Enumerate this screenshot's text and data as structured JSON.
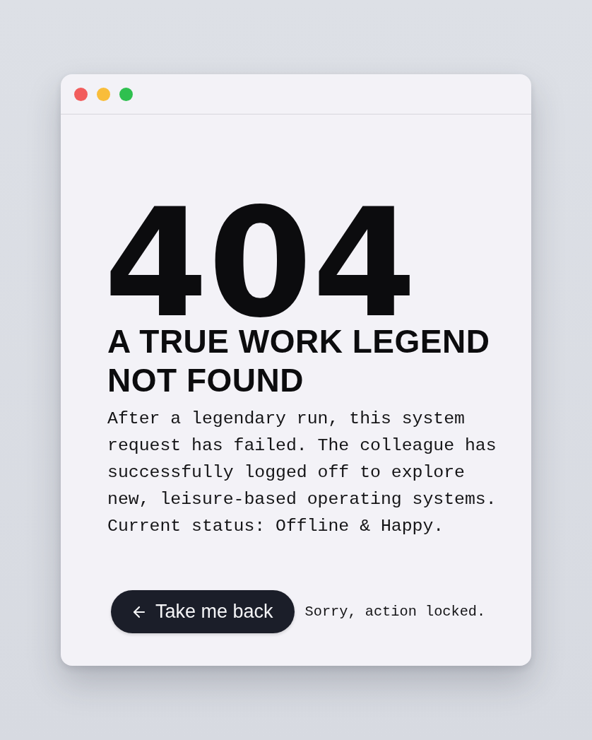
{
  "window": {
    "controls": [
      {
        "color": "#f25d5d"
      },
      {
        "color": "#f9bd3a"
      },
      {
        "color": "#2fc04f"
      }
    ]
  },
  "error_code": "404",
  "heading": "A TRUE WORK LEGEND NOT FOUND",
  "message": "After a legendary run, this system request has failed. The colleague has successfully logged off to explore new, leisure-based operating systems. Current status: Offline & Happy.",
  "action": {
    "label": "Take me back"
  },
  "note": "Sorry, action locked."
}
